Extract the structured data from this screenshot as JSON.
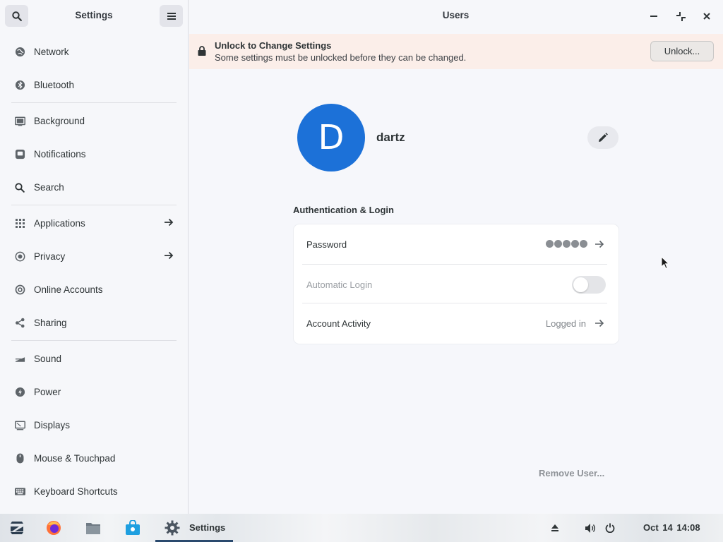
{
  "sidebar": {
    "title": "Settings",
    "groups": [
      [
        {
          "label": "Network",
          "icon": "network-icon"
        },
        {
          "label": "Bluetooth",
          "icon": "bluetooth-icon"
        }
      ],
      [
        {
          "label": "Background",
          "icon": "background-icon"
        },
        {
          "label": "Notifications",
          "icon": "notifications-icon"
        },
        {
          "label": "Search",
          "icon": "search-icon"
        }
      ],
      [
        {
          "label": "Applications",
          "icon": "applications-icon",
          "arrow": true
        },
        {
          "label": "Privacy",
          "icon": "privacy-icon",
          "arrow": true
        },
        {
          "label": "Online Accounts",
          "icon": "online-accounts-icon"
        },
        {
          "label": "Sharing",
          "icon": "sharing-icon"
        }
      ],
      [
        {
          "label": "Sound",
          "icon": "sound-icon"
        },
        {
          "label": "Power",
          "icon": "power-icon"
        },
        {
          "label": "Displays",
          "icon": "displays-icon"
        },
        {
          "label": "Mouse & Touchpad",
          "icon": "mouse-icon"
        },
        {
          "label": "Keyboard Shortcuts",
          "icon": "keyboard-icon"
        }
      ]
    ]
  },
  "window": {
    "title": "Users"
  },
  "infobar": {
    "title": "Unlock to Change Settings",
    "subtitle": "Some settings must be unlocked before they can be changed.",
    "button_label": "Unlock..."
  },
  "user": {
    "avatar_letter": "D",
    "name": "dartz",
    "avatar_color": "#1c71d8"
  },
  "auth": {
    "section_title": "Authentication & Login",
    "password_label": "Password",
    "password_dots": 5,
    "autologin_label": "Automatic Login",
    "autologin_enabled": false,
    "activity_label": "Account Activity",
    "activity_value": "Logged in"
  },
  "remove_user_label": "Remove User...",
  "taskbar": {
    "active_app_label": "Settings",
    "clock": "Oct 14  14:08"
  }
}
